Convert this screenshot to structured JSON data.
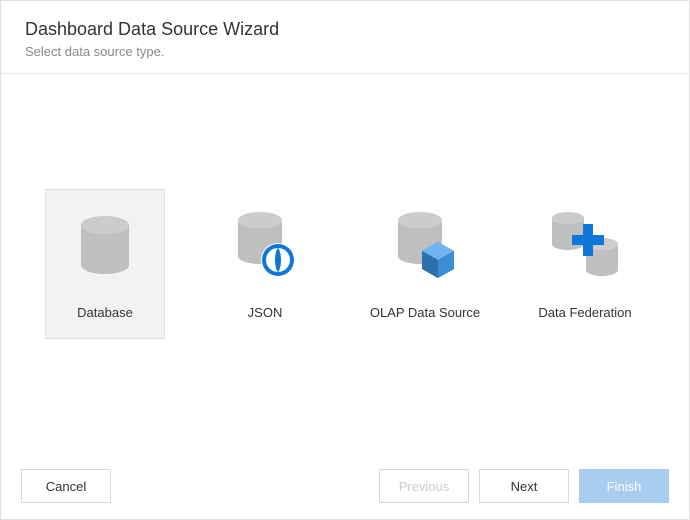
{
  "header": {
    "title": "Dashboard Data Source Wizard",
    "subtitle": "Select data source type."
  },
  "options": [
    {
      "key": "database",
      "label": "Database",
      "selected": true
    },
    {
      "key": "json",
      "label": "JSON",
      "selected": false
    },
    {
      "key": "olap",
      "label": "OLAP Data Source",
      "selected": false
    },
    {
      "key": "federation",
      "label": "Data Federation",
      "selected": false
    }
  ],
  "footer": {
    "cancel": "Cancel",
    "previous": "Previous",
    "next": "Next",
    "finish": "Finish"
  }
}
